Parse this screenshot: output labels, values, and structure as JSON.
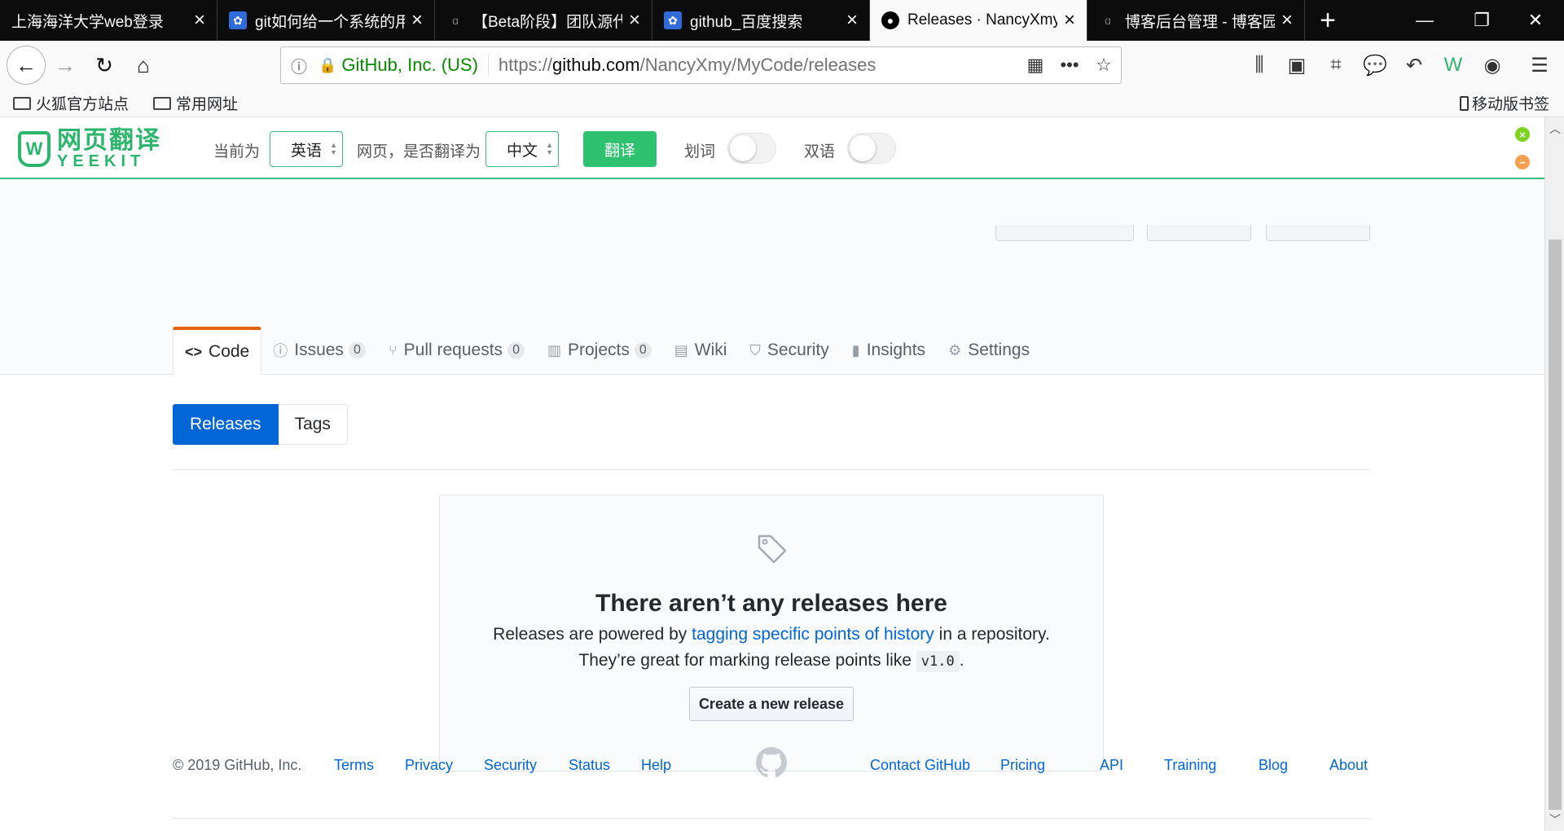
{
  "browser": {
    "tabs": [
      {
        "title": "上海海洋大学web登录",
        "favicon": "none",
        "active": false
      },
      {
        "title": "git如何给一个系统的用",
        "favicon": "baidu-paw-icon",
        "active": false
      },
      {
        "title": "【Beta阶段】团队源代",
        "favicon": "cnblogs-icon",
        "active": false
      },
      {
        "title": "github_百度搜索",
        "favicon": "baidu-paw-icon",
        "active": false
      },
      {
        "title": "Releases · NancyXmy",
        "favicon": "github-icon",
        "active": true
      },
      {
        "title": "博客后台管理 - 博客园",
        "favicon": "cnblogs-icon",
        "active": false
      }
    ],
    "new_tab": "+",
    "url_identity": "GitHub, Inc. (US)",
    "url_prefix": "https://",
    "url_host": "github.com",
    "url_path": "/NancyXmy/MyCode/releases",
    "bookmarks": [
      "火狐官方站点",
      "常用网址"
    ],
    "mobile_bookmarks": "移动版书签"
  },
  "translator": {
    "logo_cn": "网页翻译",
    "logo_en": "YEEKIT",
    "current_label": "当前为",
    "source_lang": "英语",
    "translate_to_label": "网页，是否翻译为",
    "target_lang": "中文",
    "translate_button": "翻译",
    "word_label": "划词",
    "bilingual_label": "双语"
  },
  "repo": {
    "tabs": [
      {
        "label": "Code",
        "icon": "code-icon",
        "active": true,
        "count": ""
      },
      {
        "label": "Issues",
        "icon": "issue-icon",
        "active": false,
        "count": "0"
      },
      {
        "label": "Pull requests",
        "icon": "pull-request-icon",
        "active": false,
        "count": "0"
      },
      {
        "label": "Projects",
        "icon": "project-icon",
        "active": false,
        "count": "0"
      },
      {
        "label": "Wiki",
        "icon": "book-icon",
        "active": false,
        "count": ""
      },
      {
        "label": "Security",
        "icon": "shield-icon",
        "active": false,
        "count": ""
      },
      {
        "label": "Insights",
        "icon": "graph-icon",
        "active": false,
        "count": ""
      },
      {
        "label": "Settings",
        "icon": "gear-icon",
        "active": false,
        "count": ""
      }
    ]
  },
  "releases": {
    "subnav": {
      "releases": "Releases",
      "tags": "Tags"
    },
    "blank_title": "There aren’t any releases here",
    "line1_before": "Releases are powered by ",
    "line1_link": "tagging specific points of history",
    "line1_after": " in a repository.",
    "line2_before": "They’re great for marking release points like ",
    "line2_code": "v1.0",
    "line2_after": ".",
    "create_button": "Create a new release"
  },
  "footer": {
    "copyright": "© 2019 GitHub, Inc.",
    "left_links": [
      "Terms",
      "Privacy",
      "Security",
      "Status",
      "Help"
    ],
    "right_links": [
      "Contact GitHub",
      "Pricing",
      "API",
      "Training",
      "Blog",
      "About"
    ]
  },
  "colors": {
    "accent": "#0366d6",
    "translator_green": "#2ec170",
    "active_tab_border": "#e36209"
  }
}
